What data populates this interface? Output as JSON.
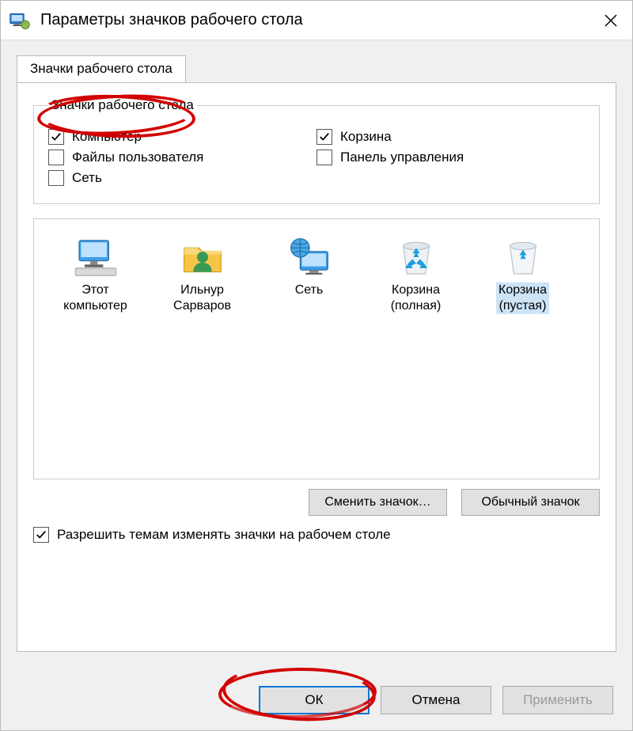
{
  "window": {
    "title": "Параметры значков рабочего стола"
  },
  "tab": {
    "label": "Значки рабочего стола"
  },
  "group": {
    "legend": "Значки рабочего стола",
    "checks": {
      "computer": {
        "label": "Компьютер",
        "checked": true
      },
      "recycle": {
        "label": "Корзина",
        "checked": true
      },
      "userfiles": {
        "label": "Файлы пользователя",
        "checked": false
      },
      "controlpanel": {
        "label": "Панель управления",
        "checked": false
      },
      "network": {
        "label": "Сеть",
        "checked": false
      }
    }
  },
  "icons": [
    {
      "id": "this-pc",
      "caption": "Этот\nкомпьютер",
      "glyph": "monitor"
    },
    {
      "id": "user",
      "caption": "Ильнур\nСарваров",
      "glyph": "userfolder"
    },
    {
      "id": "network",
      "caption": "Сеть",
      "glyph": "globe-monitor"
    },
    {
      "id": "bin-full",
      "caption": "Корзина\n(полная)",
      "glyph": "bin-full"
    },
    {
      "id": "bin-empty",
      "caption": "Корзина\n(пустая)",
      "glyph": "bin-empty"
    }
  ],
  "buttons": {
    "change_icon": "Сменить значок…",
    "default_icon": "Обычный значок"
  },
  "allow_themes": {
    "label": "Разрешить темам изменять значки на рабочем столе",
    "checked": true
  },
  "dialog": {
    "ok": "ОК",
    "cancel": "Отмена",
    "apply": "Применить"
  }
}
